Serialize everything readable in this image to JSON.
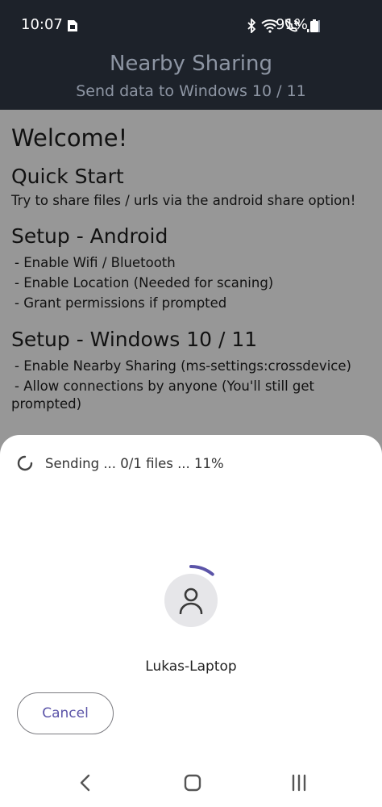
{
  "status_bar": {
    "time": "10:07",
    "battery": "91%",
    "icons": [
      "sim-card-icon",
      "bluetooth-icon",
      "wifi-icon",
      "wifi-calling-icon",
      "signal-icon",
      "battery-icon"
    ]
  },
  "app_bar": {
    "title": "Nearby Sharing",
    "subtitle": "Send data to Windows 10 / 11"
  },
  "content": {
    "welcome": "Welcome!",
    "quick_start": {
      "heading": "Quick Start",
      "text": "Try to share files / urls via the android share option!"
    },
    "setup_android": {
      "heading": "Setup - Android",
      "items": [
        "- Enable Wifi / Bluetooth",
        "- Enable Location (Needed for scaning)",
        "- Grant permissions if prompted"
      ]
    },
    "setup_windows": {
      "heading": "Setup - Windows 10 / 11",
      "items": [
        "- Enable Nearby Sharing (ms-settings:crossdevice)",
        "- Allow connections by anyone (You'll still get",
        "prompted)"
      ]
    }
  },
  "sheet": {
    "sending_status": "Sending ... 0/1 files ... 11%",
    "progress": 0.11,
    "device_name": "Lukas-Laptop",
    "cancel_label": "Cancel"
  },
  "colors": {
    "header_bg": "#1d222a",
    "accent": "#5b54a8"
  }
}
